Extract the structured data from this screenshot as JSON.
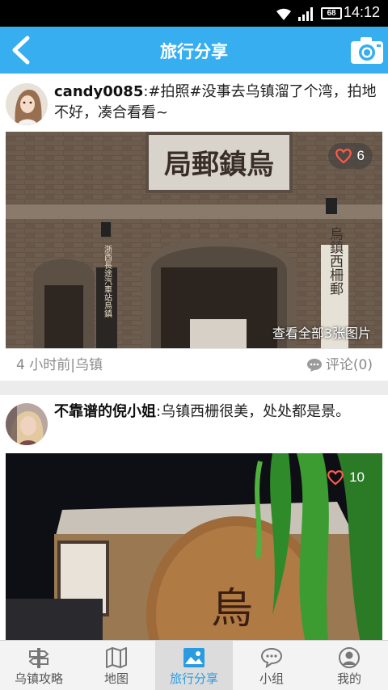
{
  "status_bar": {
    "time": "14:12",
    "battery": "68"
  },
  "header": {
    "title": "旅行分享",
    "back_icon": "back-arrow-icon",
    "camera_icon": "camera-icon"
  },
  "posts": [
    {
      "username": "candy0085",
      "text": ":#拍照#没事去乌镇溜了个湾，拍地不好，凑合看看~",
      "likes": "6",
      "view_all": "查看全部3张图片",
      "time_location": "4 小时前|乌镇",
      "comments": "评论(0)",
      "photo_text": {
        "plaque": "局郵鎮烏",
        "left_sign": "浙西長途汽車站烏鎮",
        "right_sign": "烏鎮西柵郵"
      }
    },
    {
      "username": "不靠谱的倪小姐",
      "text": ":乌镇西栅很美，处处都是景。",
      "likes": "10",
      "photo_text": {
        "door_text": "烏"
      }
    }
  ],
  "tabs": [
    {
      "label": "乌镇攻略",
      "icon": "signpost-icon",
      "active": false
    },
    {
      "label": "地图",
      "icon": "map-icon",
      "active": false
    },
    {
      "label": "旅行分享",
      "icon": "photo-icon",
      "active": true
    },
    {
      "label": "小组",
      "icon": "chat-bubbles-icon",
      "active": false
    },
    {
      "label": "我的",
      "icon": "person-icon",
      "active": false
    }
  ],
  "colors": {
    "header_bg": "#36aef0",
    "tab_active": "#2a9be0",
    "like_heart": "#ff5a4a"
  }
}
